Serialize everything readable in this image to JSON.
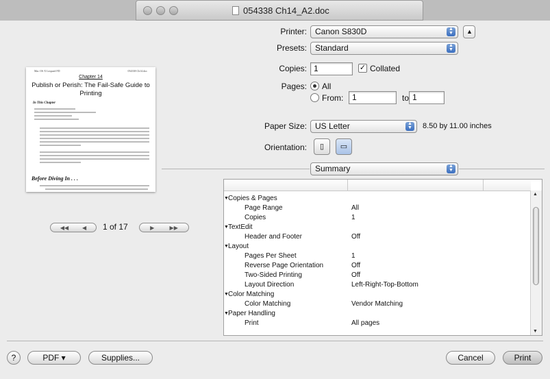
{
  "window": {
    "title": "054338 Ch14_A2.doc"
  },
  "preview": {
    "header_left": "Mac OS X Leopard FD",
    "header_right": "054338 Ch14.doc",
    "chapter": "Chapter 14",
    "title": "Publish or Perish: The Fail-Safe Guide to Printing",
    "subhead": "In This Chapter",
    "section": "Before Diving In . . .",
    "page_indicator": "1 of 17"
  },
  "printer": {
    "label": "Printer:",
    "value": "Canon S830D"
  },
  "presets": {
    "label": "Presets:",
    "value": "Standard"
  },
  "copies": {
    "label": "Copies:",
    "value": "1",
    "collated_label": "Collated",
    "collated": true
  },
  "pages": {
    "label": "Pages:",
    "all_label": "All",
    "from_label": "From:",
    "from_value": "1",
    "to_label": "to:",
    "to_value": "1"
  },
  "paper": {
    "label": "Paper Size:",
    "value": "US Letter",
    "dims": "8.50 by 11.00 inches"
  },
  "orientation": {
    "label": "Orientation:"
  },
  "panel": {
    "value": "Summary"
  },
  "summary_rows": [
    {
      "key": "Copies & Pages",
      "value": "",
      "group": true
    },
    {
      "key": "Page Range",
      "value": "All",
      "group": false
    },
    {
      "key": "Copies",
      "value": "1",
      "group": false
    },
    {
      "key": "TextEdit",
      "value": "",
      "group": true
    },
    {
      "key": "Header and Footer",
      "value": "Off",
      "group": false
    },
    {
      "key": "Layout",
      "value": "",
      "group": true
    },
    {
      "key": "Pages Per Sheet",
      "value": "1",
      "group": false
    },
    {
      "key": "Reverse Page Orientation",
      "value": "Off",
      "group": false
    },
    {
      "key": "Two-Sided Printing",
      "value": "Off",
      "group": false
    },
    {
      "key": "Layout Direction",
      "value": "Left-Right-Top-Bottom",
      "group": false
    },
    {
      "key": "Color Matching",
      "value": "",
      "group": true
    },
    {
      "key": "Color Matching",
      "value": "Vendor Matching",
      "group": false
    },
    {
      "key": "Paper Handling",
      "value": "",
      "group": true
    },
    {
      "key": "Print",
      "value": "All pages",
      "group": false
    }
  ],
  "footer": {
    "help": "?",
    "pdf": "PDF ▾",
    "supplies": "Supplies...",
    "cancel": "Cancel",
    "print": "Print"
  }
}
